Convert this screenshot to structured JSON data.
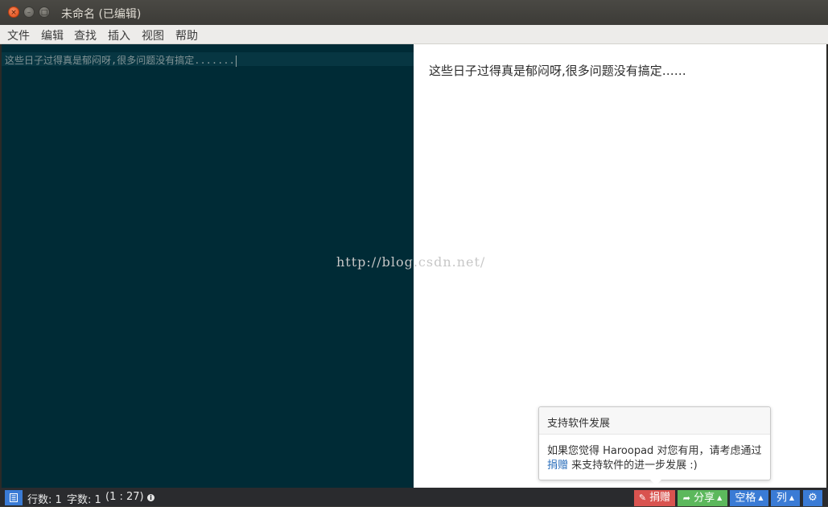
{
  "window": {
    "title": "未命名 (已编辑)",
    "close_glyph": "×",
    "min_glyph": "–",
    "max_glyph": "□"
  },
  "menu": {
    "items": [
      "文件",
      "编辑",
      "查找",
      "插入",
      "视图",
      "帮助"
    ]
  },
  "editor": {
    "text": "这些日子过得真是郁闷呀,很多问题没有搞定.......",
    "background": "#002b36"
  },
  "preview": {
    "text": "这些日子过得真是郁闷呀,很多问题没有搞定……"
  },
  "watermark": "http://blog.csdn.net/",
  "popover": {
    "title": "支持软件发展",
    "body_before": "如果您觉得 Haroopad 对您有用，请考虑通过",
    "body_link": "捐赠",
    "body_after": " 来支持软件的进一步发展 :)"
  },
  "status": {
    "lines_label": "行数: 1",
    "chars_label": "字数: 1",
    "cursor_pos": "(1 : 27)",
    "info_glyph": "i",
    "toggle_icon": "list-icon",
    "donate_label": "捐赠",
    "share_label": "分享",
    "space_label": "空格",
    "col_label": "列",
    "gear_glyph": "⚙",
    "colors": {
      "donate": "#d9534f",
      "share": "#5cb85c",
      "primary": "#3a7bd5"
    }
  }
}
